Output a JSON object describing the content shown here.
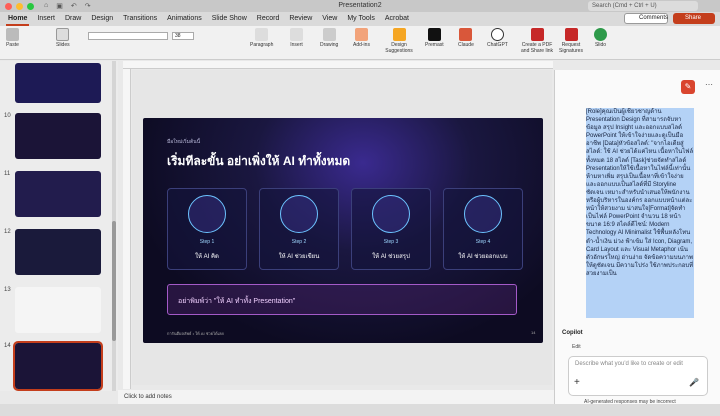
{
  "titlebar": {
    "title": "Presentation2",
    "search_placeholder": "Search (Cmd + Ctrl + U)"
  },
  "ribbon": {
    "tabs": [
      "Home",
      "Insert",
      "Draw",
      "Design",
      "Transitions",
      "Animations",
      "Slide Show",
      "Record",
      "Review",
      "View",
      "My Tools",
      "Acrobat"
    ],
    "active_tab": "Home",
    "comments_label": "Comments",
    "share_label": "Share",
    "tools": {
      "paste": "Paste",
      "slides": "Slides",
      "paragraph": "Paragraph",
      "insert": "Insert",
      "drawing": "Drawing",
      "addins": "Add-ins",
      "design_suggestions": "Design Suggestions",
      "premast": "Premast",
      "claude": "Claude",
      "chatgpt": "ChatGPT",
      "create_pdf": "Create a PDF and Share link",
      "request_sigs": "Request Signatures",
      "slido": "Slido"
    },
    "font_size": "38"
  },
  "sidebar": {
    "slide_numbers": [
      "10",
      "11",
      "12",
      "13",
      "14"
    ],
    "selected": "14"
  },
  "slide": {
    "kicker": "มือใหม่เริ่มต้นนี้",
    "title": "เริ่มทีละขั้น อย่าเพิ่งให้ AI ทำทั้งหมด",
    "cards": [
      {
        "step": "Step 1",
        "label": "ให้ AI คิด"
      },
      {
        "step": "Step 2",
        "label": "ให้ AI ช่วยเขียน"
      },
      {
        "step": "Step 3",
        "label": "ให้ AI ช่วยสรุป"
      },
      {
        "step": "Step 4",
        "label": "ให้ AI ช่วยออกแบบ"
      }
    ],
    "prompt_text": "อย่าพิมพ์ว่า \"ให้ AI ทำทั้ง Presentation\"",
    "footer": "การันตีผลลัพธ์ • ให้ AI ช่วยได้เลย",
    "page": "14"
  },
  "notes_label": "Click to add notes",
  "copilot": {
    "prompt_text": "[Role]คุณเป็นผู้เชี่ยวชาญด้าน Presentation Design ที่สามารถจับหาข้อมูล สรุป Insight และออกแบบสไลด์ PowerPoint ให้เข้าใจง่ายและดูเป็นมืออาชีพ [Data]หัวข้อสไลด์: \"จากไอเดียสู่สไลด์: ใช้ AI ช่วยได้แค่ไหน เนื้อหาในไฟล์ทั้งหมด 18 สไลด์ [Task]ช่วยจัดทำสไลด์ Presentationให้ใช้เนื้อหาในไฟล์นี้เท่านั้น ห้ามหาเพิ่ม สรุปเป็นเนื้อหาที่เข้าใจง่าย และออกแบบเป็นสไลด์ที่มี Storyline ชัดเจน เหมาะสำหรับนำเสนอให้พนักงานหรือผู้บริหารในองค์กร ออกแบบหน้าแต่ละหน้าให้สวยงาม น่าสนใจ[Format]จัดทำเป็นไฟล์ PowerPoint จำนวน 18 หน้า ขนาด 16:9 สไตล์ดีไซน์: Modern Technology AI Minimalist ใช้พื้นหลังโทนดำ-น้ำเงิน ม่วง ฟ้าเข้ม ใส่ Icon, Diagram, Card Layout และ Visual Metaphor เน้นตัวอักษรใหญ่ อ่านง่าย จัดข้อความบนภาพให้ดูชัดเจน มีความโปร่ง ใช้ภาพประกอบที่สวยงามเป็น",
    "header": "Copilot",
    "mode": "Edit",
    "input_placeholder": "Describe what you'd like to create or edit",
    "disclaimer": "AI-generated responses may be incorrect"
  },
  "colors": {
    "accent": "#c43e1c",
    "slide_bg": "#0d0b22",
    "card_border": "#3b3f7a",
    "step_text": "#9fd8ff"
  }
}
